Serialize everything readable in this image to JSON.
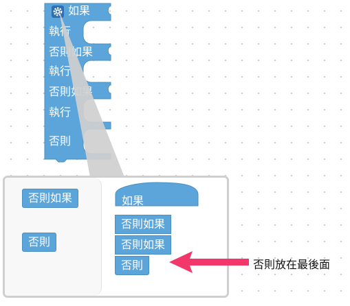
{
  "main_block": {
    "if_label": "如果",
    "do_label_1": "執行",
    "else_if_label_1": "否則如果",
    "do_label_2": "執行",
    "else_if_label_2": "否則如果",
    "do_label_3": "執行",
    "else_label": "否則",
    "gear_icon": "gear-icon"
  },
  "mutator": {
    "flyout": {
      "items": [
        {
          "label": "否則如果"
        },
        {
          "label": "否則"
        }
      ]
    },
    "workspace": {
      "stack": [
        {
          "label": "如果"
        },
        {
          "label": "否則如果"
        },
        {
          "label": "否則如果"
        },
        {
          "label": "否則"
        }
      ]
    }
  },
  "annotation": {
    "text": "否則放在最後面",
    "arrow_color": "#f2386b"
  },
  "colors": {
    "block_fill": "#5ba5da",
    "block_stroke": "#4a8fc2",
    "callout_fill": "#cfcfcf"
  }
}
